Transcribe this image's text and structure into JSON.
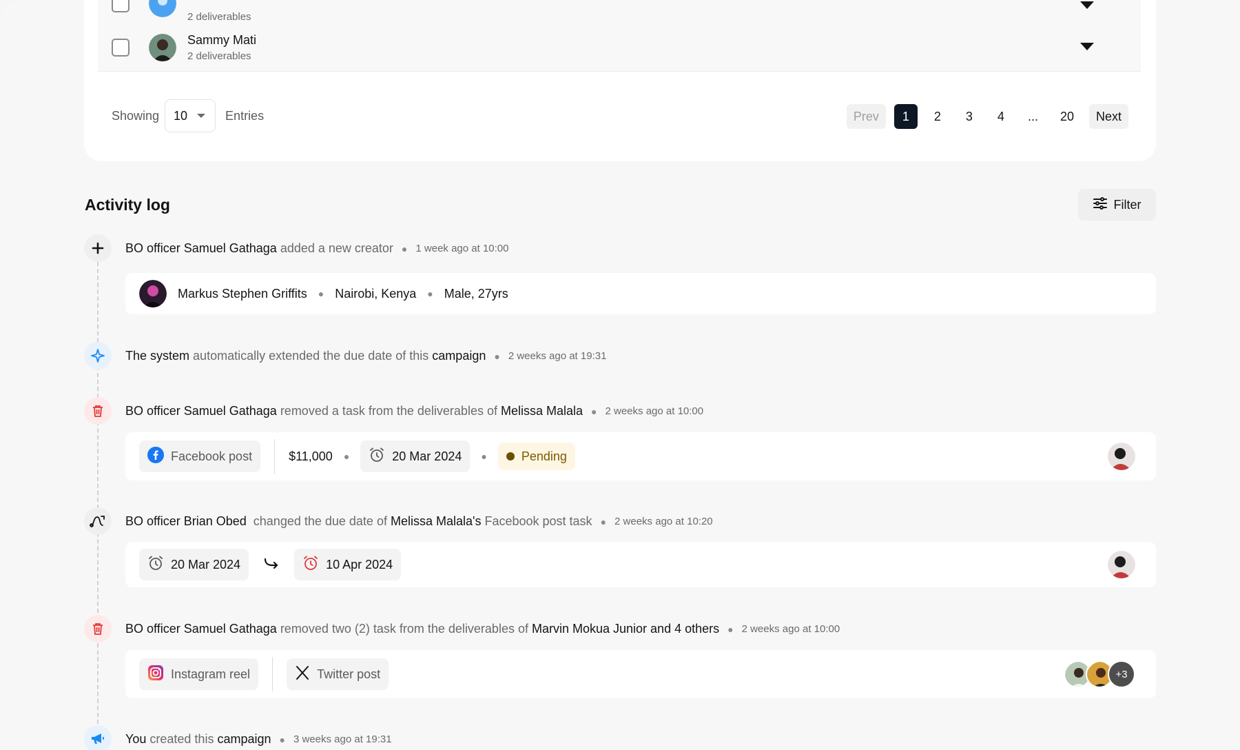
{
  "table": {
    "rows": [
      {
        "name": "",
        "sub": "2 deliverables"
      },
      {
        "name": "Sammy Mati",
        "sub": "2 deliverables"
      }
    ]
  },
  "pagination": {
    "showing_label": "Showing",
    "page_size": "10",
    "entries_label": "Entries",
    "prev": "Prev",
    "pages": [
      "1",
      "2",
      "3",
      "4",
      "...",
      "20"
    ],
    "current": "1",
    "next": "Next"
  },
  "activity": {
    "title": "Activity log",
    "filter_label": "Filter",
    "events": [
      {
        "actor": "BO officer Samuel Gathaga",
        "action": "added a new creator",
        "time": "1 week ago at 10:00",
        "creator": {
          "name": "Markus Stephen Griffits",
          "location": "Nairobi, Kenya",
          "info": "Male, 27yrs"
        }
      },
      {
        "actor": "The system",
        "action": "automatically extended the due date of this",
        "object": "campaign",
        "time": "2 weeks ago at 19:31"
      },
      {
        "actor": "BO officer Samuel Gathaga",
        "action": "removed a task from the deliverables of",
        "object": "Melissa Malala",
        "time": "2 weeks ago at 10:00",
        "task": {
          "platform": "Facebook post",
          "amount": "$11,000",
          "date": "20 Mar 2024",
          "status": "Pending"
        }
      },
      {
        "actor": "BO officer Brian Obed",
        "action": "changed the due date of",
        "object": "Melissa Malala's",
        "object_suffix": "Facebook post task",
        "time": "2 weeks ago at 10:20",
        "from_date": "20 Mar 2024",
        "to_date": "10 Apr 2024"
      },
      {
        "actor": "BO officer Samuel Gathaga",
        "action": "removed two (2) task from the deliverables of",
        "object": "Marvin Mokua Junior and 4 others",
        "time": "2 weeks ago at 10:00",
        "tasks": [
          "Instagram reel",
          "Twitter post"
        ],
        "more": "+3"
      },
      {
        "actor": "You",
        "action": "created this",
        "object": "campaign",
        "time": "3 weeks ago at 19:31"
      }
    ]
  },
  "colors": {
    "accent_dark": "#0e1726",
    "system_blue": "#1a8cf0",
    "danger_red": "#e03a3a",
    "pending_bg": "#fdf6e3"
  }
}
